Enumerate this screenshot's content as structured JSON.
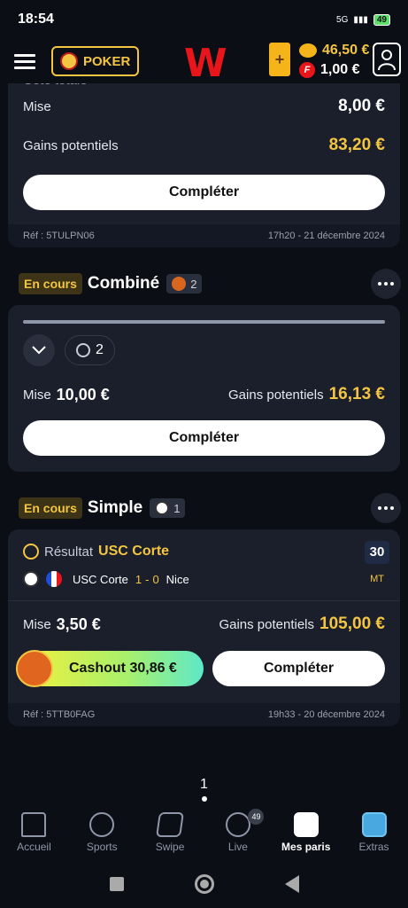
{
  "status_bar": {
    "time": "18:54",
    "network": "5G",
    "battery": "49"
  },
  "header": {
    "poker_label": "POKER",
    "logo": "W",
    "add_funds": "+",
    "balance_cash": "46,50 €",
    "balance_freebet": "1,00 €",
    "freebet_icon_letter": "F"
  },
  "card1": {
    "cote_label": "Cote totale",
    "mise_label": "Mise",
    "mise_value": "8,00 €",
    "gains_label": "Gains potentiels",
    "gains_value": "83,20 €",
    "complete_label": "Compléter",
    "ref": "Réf : 5TULPN06",
    "date": "17h20 - 21 décembre 2024"
  },
  "bet2": {
    "status": "En cours",
    "type": "Combiné",
    "count": "2",
    "pill_count": "2",
    "mise_label": "Mise",
    "mise_value": "10,00 €",
    "gains_label": "Gains potentiels",
    "gains_value": "16,13 €",
    "complete_label": "Compléter"
  },
  "bet3": {
    "status": "En cours",
    "type": "Simple",
    "count": "1",
    "result_label": "Résultat",
    "team_selected": "USC Corte",
    "home_team": "USC Corte",
    "home_score": "1",
    "sep": "-",
    "away_score": "0",
    "away_team": "Nice",
    "minute": "30",
    "period": "MT",
    "mise_label": "Mise",
    "mise_value": "3,50 €",
    "gains_label": "Gains potentiels",
    "gains_value": "105,00 €",
    "cashout_label": "Cashout 30,86 €",
    "complete_label": "Compléter",
    "ref": "Réf : 5TTB0FAG",
    "date": "19h33 - 20 décembre 2024"
  },
  "page_indicator": "1",
  "bottom_nav": [
    {
      "label": "Accueil",
      "icon": "home-icon"
    },
    {
      "label": "Sports",
      "icon": "search-icon"
    },
    {
      "label": "Swipe",
      "icon": "cards-icon"
    },
    {
      "label": "Live",
      "icon": "play-icon",
      "badge": "49"
    },
    {
      "label": "Mes paris",
      "icon": "ticket-icon",
      "active": true
    },
    {
      "label": "Extras",
      "icon": "gift-icon"
    }
  ],
  "colors": {
    "accent_yellow": "#f4c542",
    "brand_red": "#e8161b",
    "card_bg": "#1b1f2c"
  }
}
